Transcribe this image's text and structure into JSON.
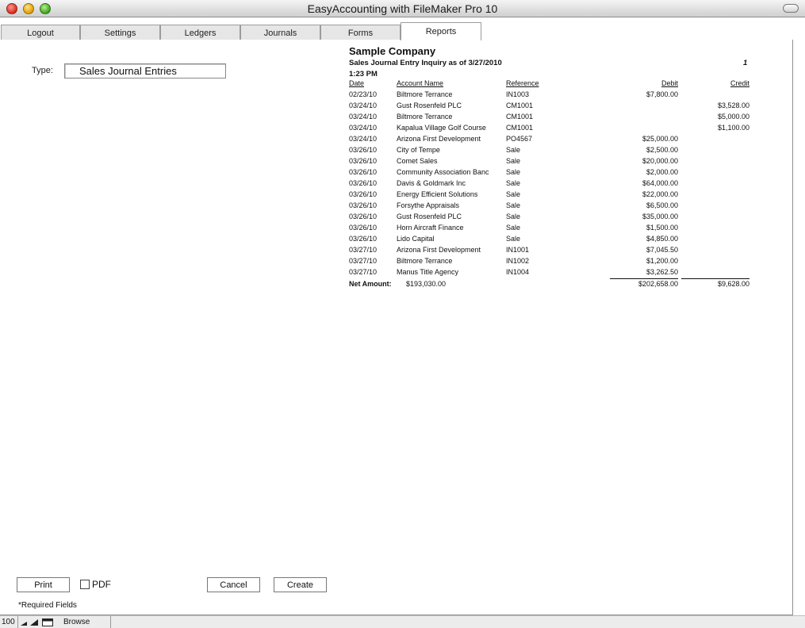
{
  "window": {
    "title": "EasyAccounting with FileMaker Pro 10"
  },
  "tabs": [
    {
      "label": "Logout"
    },
    {
      "label": "Settings"
    },
    {
      "label": "Ledgers"
    },
    {
      "label": "Journals"
    },
    {
      "label": "Forms"
    },
    {
      "label": "Reports",
      "active": true
    }
  ],
  "form": {
    "type_label": "Type:",
    "type_value": "Sales Journal Entries"
  },
  "report": {
    "company": "Sample Company",
    "inquiry": "Sales Journal Entry Inquiry as of 3/27/2010",
    "page": "1",
    "time": "1:23 PM",
    "columns": {
      "date": "Date",
      "account": "Account Name",
      "reference": "Reference",
      "debit": "Debit",
      "credit": "Credit"
    },
    "rows": [
      {
        "date": "02/23/10",
        "account": "Biltmore Terrance",
        "reference": "IN1003",
        "debit": "$7,800.00",
        "credit": ""
      },
      {
        "date": "03/24/10",
        "account": "Gust Rosenfeld PLC",
        "reference": "CM1001",
        "debit": "",
        "credit": "$3,528.00"
      },
      {
        "date": "03/24/10",
        "account": "Biltmore Terrance",
        "reference": "CM1001",
        "debit": "",
        "credit": "$5,000.00"
      },
      {
        "date": "03/24/10",
        "account": "Kapalua Village Golf Course",
        "reference": "CM1001",
        "debit": "",
        "credit": "$1,100.00"
      },
      {
        "date": "03/24/10",
        "account": "Arizona First Development",
        "reference": "PO4567",
        "debit": "$25,000.00",
        "credit": ""
      },
      {
        "date": "03/26/10",
        "account": "City of Tempe",
        "reference": "Sale",
        "debit": "$2,500.00",
        "credit": ""
      },
      {
        "date": "03/26/10",
        "account": "Comet Sales",
        "reference": "Sale",
        "debit": "$20,000.00",
        "credit": ""
      },
      {
        "date": "03/26/10",
        "account": "Community Association Banc",
        "reference": "Sale",
        "debit": "$2,000.00",
        "credit": ""
      },
      {
        "date": "03/26/10",
        "account": "Davis & Goldmark Inc",
        "reference": "Sale",
        "debit": "$64,000.00",
        "credit": ""
      },
      {
        "date": "03/26/10",
        "account": "Energy Efficient Solutions",
        "reference": "Sale",
        "debit": "$22,000.00",
        "credit": ""
      },
      {
        "date": "03/26/10",
        "account": "Forsythe Appraisals",
        "reference": "Sale",
        "debit": "$6,500.00",
        "credit": ""
      },
      {
        "date": "03/26/10",
        "account": "Gust Rosenfeld PLC",
        "reference": "Sale",
        "debit": "$35,000.00",
        "credit": ""
      },
      {
        "date": "03/26/10",
        "account": "Horn Aircraft Finance",
        "reference": "Sale",
        "debit": "$1,500.00",
        "credit": ""
      },
      {
        "date": "03/26/10",
        "account": "Lido Capital",
        "reference": "Sale",
        "debit": "$4,850.00",
        "credit": ""
      },
      {
        "date": "03/27/10",
        "account": "Arizona First Development",
        "reference": "IN1001",
        "debit": "$7,045.50",
        "credit": ""
      },
      {
        "date": "03/27/10",
        "account": "Biltmore Terrance",
        "reference": "IN1002",
        "debit": "$1,200.00",
        "credit": ""
      },
      {
        "date": "03/27/10",
        "account": "Manus Title Agency",
        "reference": "IN1004",
        "debit": "$3,262.50",
        "credit": ""
      }
    ],
    "net_label": "Net Amount:",
    "net_value": "$193,030.00",
    "total_debit": "$202,658.00",
    "total_credit": "$9,628.00"
  },
  "buttons": {
    "print": "Print",
    "pdf": "PDF",
    "cancel": "Cancel",
    "create": "Create"
  },
  "required_note": "*Required Fields",
  "status": {
    "zoom": "100",
    "mode": "Browse"
  }
}
